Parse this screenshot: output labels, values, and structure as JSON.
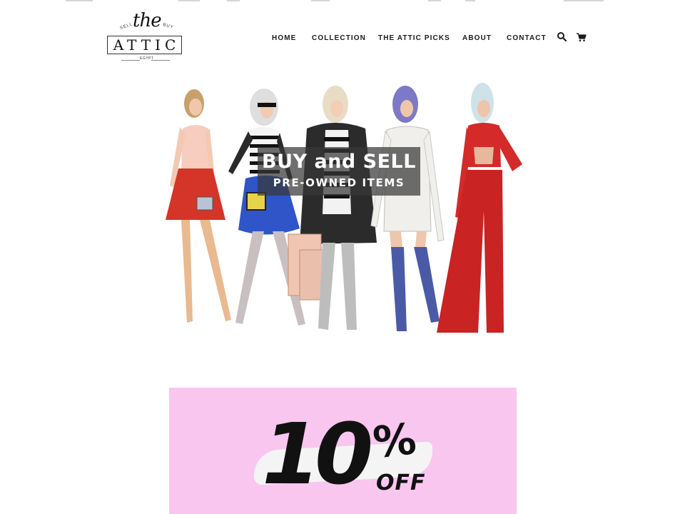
{
  "brand": {
    "script": "the",
    "name": "ATTIC",
    "left_tag": "SELL",
    "right_tag": "BUY",
    "location": "EGYPT"
  },
  "nav": {
    "items": [
      {
        "label": "HOME"
      },
      {
        "label": "COLLECTION"
      },
      {
        "label": "THE ATTIC PICKS"
      },
      {
        "label": "ABOUT"
      },
      {
        "label": "CONTACT"
      }
    ],
    "icons": [
      "search-icon",
      "cart-icon"
    ]
  },
  "hero": {
    "title": "BUY and SELL",
    "subtitle": "PRE-OWNED ITEMS"
  },
  "promo": {
    "amount": "10",
    "percent_sign": "%",
    "off_label": "OFF",
    "background": "#f8c6ef"
  },
  "colors": {
    "accent_red": "#d42a2a",
    "accent_blue": "#2f55c8",
    "text": "#1a1a1a"
  }
}
